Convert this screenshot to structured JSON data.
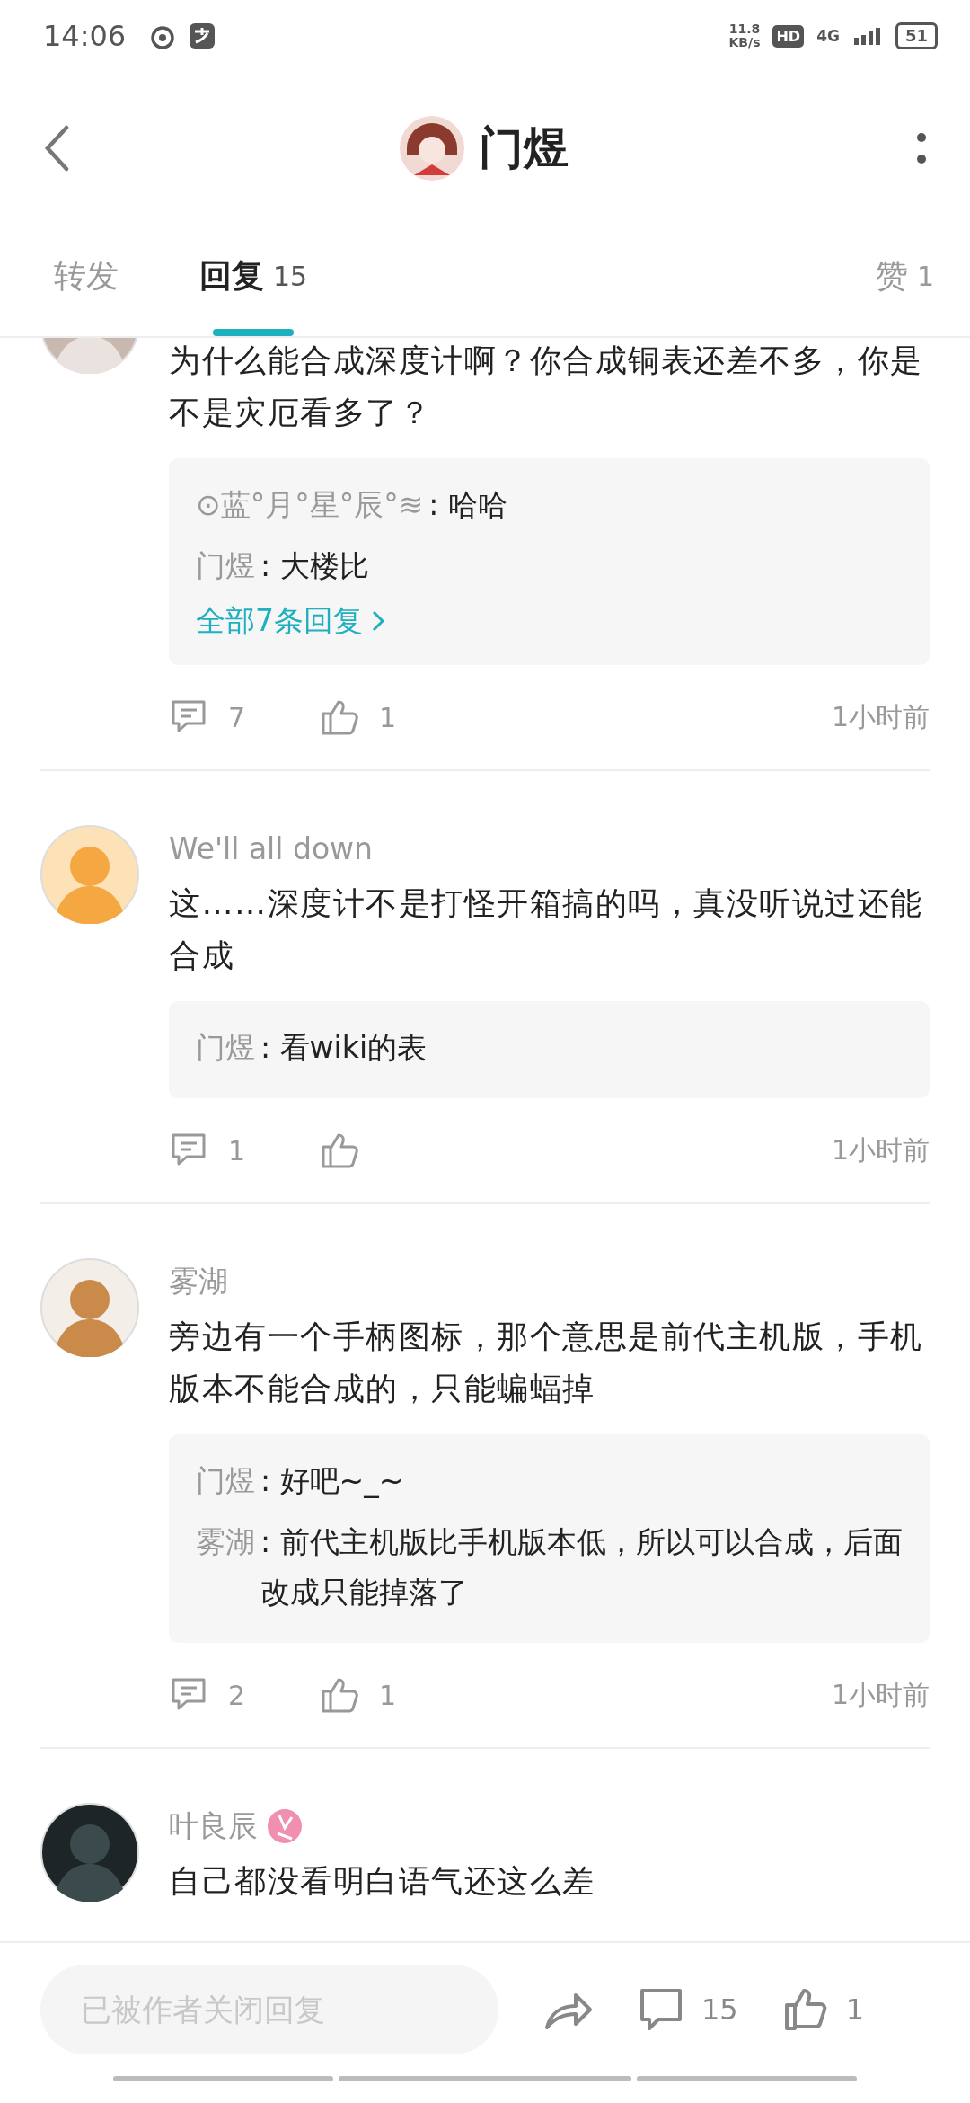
{
  "status_bar": {
    "time": "14:06",
    "speed": "11.8",
    "speed_unit": "KB/s",
    "hd": "HD",
    "network": "4G",
    "battery": "51"
  },
  "header": {
    "title": "门煜"
  },
  "tabs": [
    {
      "label": "转发",
      "selected": false
    },
    {
      "label": "回复",
      "count": "15",
      "selected": true
    },
    {
      "label": "赞",
      "count": "1",
      "selected": false
    }
  ],
  "comments": [
    {
      "text": "为什么能合成深度计啊？你合成铜表还差不多，你是不是灾厄看多了？",
      "replies": [
        {
          "author": "⊙蓝°月°星°辰°≋",
          "text": ": 哈哈"
        },
        {
          "author": "门煜",
          "text": ": 大楼比"
        }
      ],
      "more": "全部7条回复",
      "reply_count": "7",
      "like_count": "1",
      "time": "1小时前"
    },
    {
      "name": "We'll all down",
      "text": "这……深度计不是打怪开箱搞的吗，真没听说过还能合成",
      "replies": [
        {
          "author": "门煜",
          "text": ": 看wiki的表"
        }
      ],
      "reply_count": "1",
      "time": "1小时前"
    },
    {
      "name": "雾湖",
      "text": "旁边有一个手柄图标，那个意思是前代主机版，手机版本不能合成的，只能蝙蝠掉",
      "replies": [
        {
          "author": "门煜",
          "text": ": 好吧~_~"
        },
        {
          "author": "雾湖",
          "text": ": 前代主机版比手机版本低，所以可以合成，后面改成只能掉落了"
        }
      ],
      "reply_count": "2",
      "like_count": "1",
      "time": "1小时前"
    },
    {
      "name": "叶良辰",
      "badge": true,
      "text": "自己都没看明白语气还这么差"
    }
  ],
  "bottom_bar": {
    "placeholder": "已被作者关闭回复",
    "comment_count": "15",
    "like_count": "1"
  }
}
